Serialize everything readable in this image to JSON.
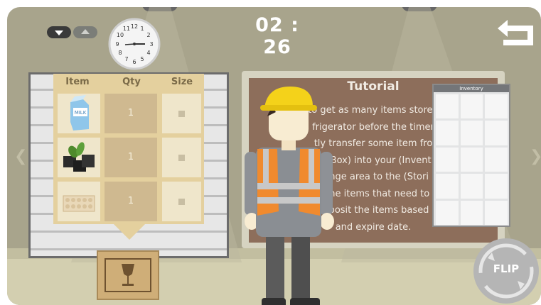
{
  "hud": {
    "timer": "02 : 26",
    "clock_numerals": [
      "12",
      "1",
      "2",
      "3",
      "4",
      "5",
      "6",
      "7",
      "8",
      "9",
      "10",
      "11"
    ]
  },
  "item_panel": {
    "headers": {
      "item": "Item",
      "qty": "Qty",
      "size": "Size"
    },
    "rows": [
      {
        "item_icon": "milk-carton-icon",
        "qty": "1"
      },
      {
        "item_icon": "charcoal-icon",
        "qty": "1"
      },
      {
        "item_icon": "egg-tray-icon",
        "qty": "1"
      }
    ]
  },
  "milk_label": "MILK",
  "tutorial": {
    "title": "Tutorial",
    "body": "to get as many items stored\nfrigerator before the timer\ntly transfer some item fro\noutBox) into your (Invent\nhange area to the (Stori\nn the items that need to\ny, d posit the items based d\nand expire date."
  },
  "inventory": {
    "title": "Inventory"
  },
  "flip_button": {
    "label": "FLIP"
  },
  "colors": {
    "wall": "#a8a48c",
    "tutorial_board": "#8d6e5b",
    "panel": "#e4d09e",
    "worker_vest": "#f08a2e",
    "worker_helmet": "#f4d21a"
  }
}
